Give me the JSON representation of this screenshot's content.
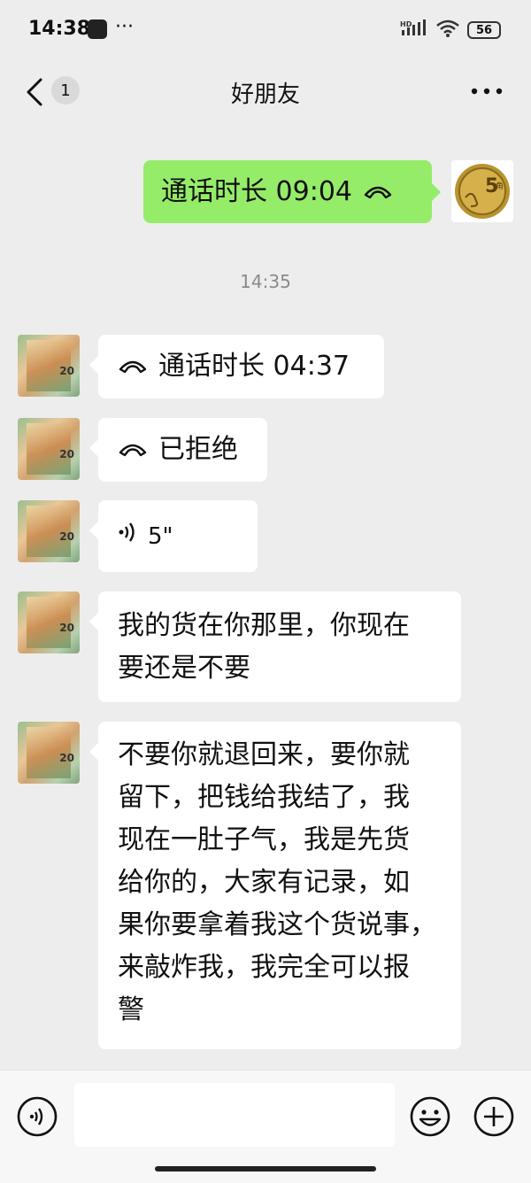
{
  "status_bar": {
    "time": "14:38",
    "more": "···",
    "network": "HD",
    "battery": "56"
  },
  "header": {
    "title": "好朋友",
    "unread_count": "1"
  },
  "messages": {
    "m1": {
      "text": "通话时长 09:04"
    },
    "time_divider": "14:35",
    "m2": {
      "text": "通话时长 04:37"
    },
    "m3": {
      "text": "已拒绝"
    },
    "m4": {
      "text": "5\""
    },
    "m5": {
      "lines": [
        "我的货在你那里，你现在",
        "要还是不要"
      ]
    },
    "m6": {
      "lines": [
        "不要你就退回来，要你就",
        "留下，把钱给我结了，我",
        "现在一肚子气，我是先货",
        "给你的，大家有记录，如",
        "果你要拿着我这个货说事，",
        "来敲炸我，我完全可以报",
        "警"
      ]
    }
  },
  "avatars": {
    "self_coin_label": "5",
    "self_coin_unit": "角",
    "peer_note_value": "20"
  },
  "input_bar": {
    "placeholder": ""
  },
  "colors": {
    "background": "#ededed",
    "outgoing_bubble": "#95ec69",
    "incoming_bubble": "#ffffff",
    "timestamp": "#8a8a8a"
  },
  "icons": [
    "back-chevron-icon",
    "more-icon",
    "phone-hangup-icon",
    "voice-wave-icon",
    "voice-input-icon",
    "emoji-icon",
    "plus-icon",
    "signal-icon",
    "wifi-icon",
    "battery-icon"
  ]
}
